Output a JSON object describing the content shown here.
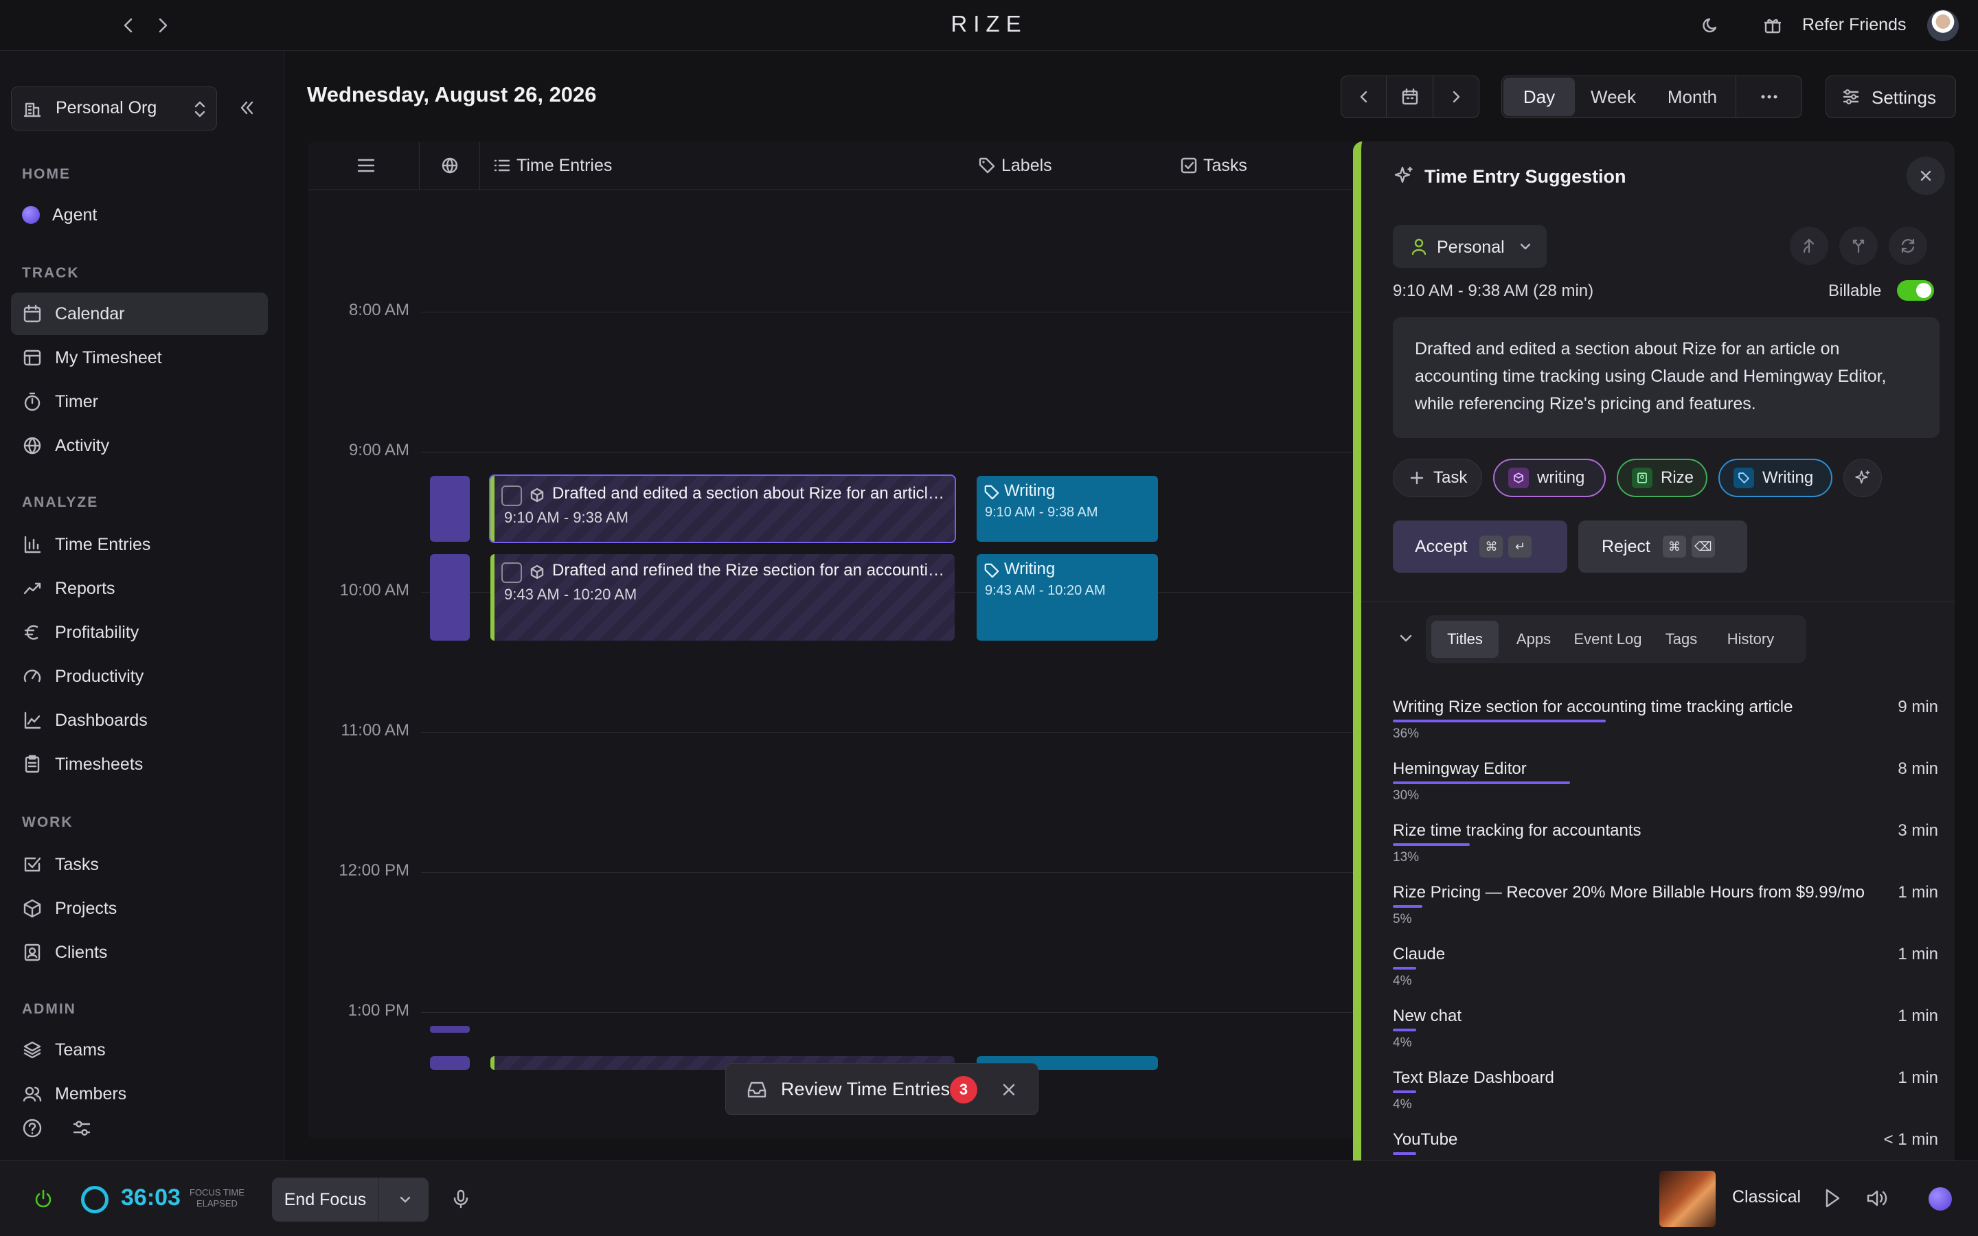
{
  "app": {
    "logo": "RIZE",
    "refer": "Refer Friends"
  },
  "sidebar": {
    "org": "Personal Org",
    "sections": {
      "home": "HOME",
      "track": "TRACK",
      "analyze": "ANALYZE",
      "work": "WORK",
      "admin": "ADMIN"
    },
    "items": {
      "agent": "Agent",
      "calendar": "Calendar",
      "timesheet": "My Timesheet",
      "timer": "Timer",
      "activity": "Activity",
      "time_entries": "Time Entries",
      "reports": "Reports",
      "profitability": "Profitability",
      "productivity": "Productivity",
      "dashboards": "Dashboards",
      "timesheets": "Timesheets",
      "tasks": "Tasks",
      "projects": "Projects",
      "clients": "Clients",
      "teams": "Teams",
      "members": "Members"
    }
  },
  "header": {
    "date": "Wednesday, August 26, 2026",
    "views": [
      "Day",
      "Week",
      "Month"
    ],
    "settings": "Settings"
  },
  "calendar": {
    "columns": {
      "time_entries": "Time Entries",
      "labels": "Labels",
      "tasks": "Tasks"
    },
    "hours": [
      "8:00 AM",
      "9:00 AM",
      "10:00 AM",
      "11:00 AM",
      "12:00 PM",
      "1:00 PM"
    ],
    "entries": [
      {
        "title": "Drafted and edited a section about Rize for an article ...",
        "time": "9:10 AM - 9:38 AM"
      },
      {
        "title": "Drafted and refined the Rize section for an accounting...",
        "time": "9:43 AM - 10:20 AM"
      }
    ],
    "labels": [
      {
        "name": "Writing",
        "time": "9:10 AM - 9:38 AM"
      },
      {
        "name": "Writing",
        "time": "9:43 AM - 10:20 AM"
      }
    ],
    "review": {
      "label": "Review Time Entries",
      "count": "3"
    }
  },
  "panel": {
    "title": "Time Entry Suggestion",
    "client": "Personal",
    "time_range": "9:10 AM - 9:38 AM (28 min)",
    "billable_label": "Billable",
    "billable": true,
    "description": "Drafted and edited a section about Rize for an article on accounting time tracking using Claude and Hemingway Editor, while referencing Rize's pricing and features.",
    "task_label": "Task",
    "tags": {
      "project": "writing",
      "client": "Rize",
      "label": "Writing"
    },
    "accept": "Accept",
    "reject": "Reject",
    "kbd": {
      "cmd": "⌘",
      "enter": "↵",
      "del": "⌫"
    },
    "tabs": [
      "Titles",
      "Apps",
      "Event Log",
      "Tags",
      "History"
    ],
    "titles": [
      {
        "name": "Writing Rize section for accounting time tracking article",
        "pct": "36%",
        "dur": "9 min",
        "frac": 0.36
      },
      {
        "name": "Hemingway Editor",
        "pct": "30%",
        "dur": "8 min",
        "frac": 0.3
      },
      {
        "name": "Rize time tracking for accountants",
        "pct": "13%",
        "dur": "3 min",
        "frac": 0.13
      },
      {
        "name": "Rize Pricing — Recover 20% More Billable Hours from $9.99/mo",
        "pct": "5%",
        "dur": "1 min",
        "frac": 0.05
      },
      {
        "name": "Claude",
        "pct": "4%",
        "dur": "1 min",
        "frac": 0.04
      },
      {
        "name": "New chat",
        "pct": "4%",
        "dur": "1 min",
        "frac": 0.04
      },
      {
        "name": "Text Blaze Dashboard",
        "pct": "4%",
        "dur": "1 min",
        "frac": 0.04
      },
      {
        "name": "YouTube",
        "pct": "",
        "dur": "< 1 min",
        "frac": 0.04
      }
    ]
  },
  "footer": {
    "timer": "36:03",
    "focus_line1": "FOCUS TIME",
    "focus_line2": "ELAPSED",
    "end_focus": "End Focus",
    "music": "Classical"
  },
  "colors": {
    "accent": "#7a5df0",
    "green": "#8fc73e",
    "label_blue": "#0c6b94",
    "badge_red": "#e5323e",
    "billable_green": "#4cc51f"
  }
}
